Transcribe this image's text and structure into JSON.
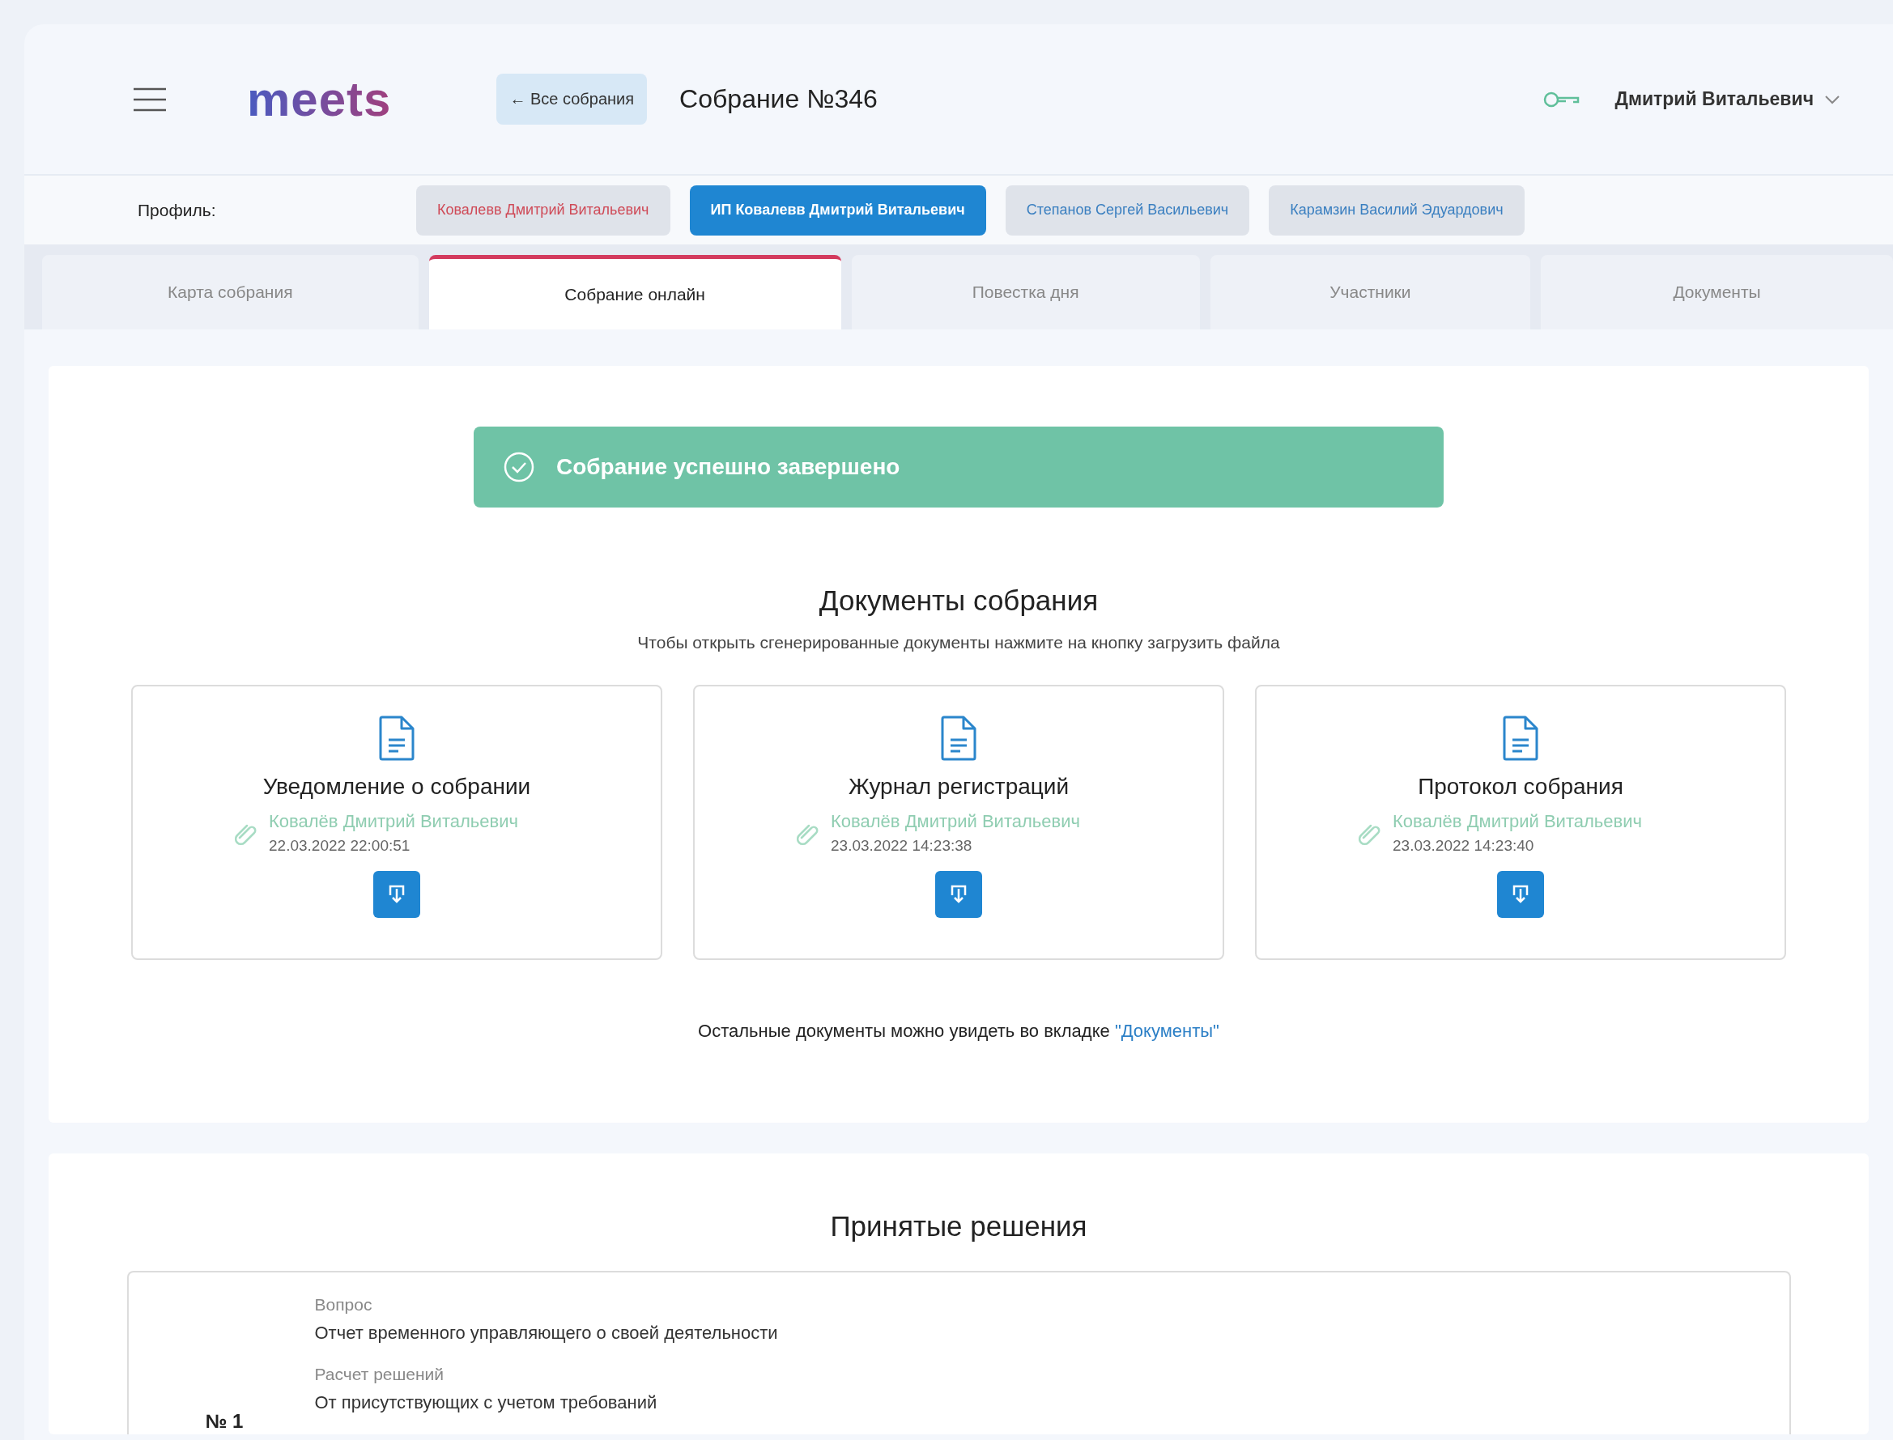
{
  "header": {
    "logo": "meets",
    "back_button": "← Все собрания",
    "title": "Собрание №346",
    "user": "Дмитрий Витальевич"
  },
  "profile": {
    "label": "Профиль:",
    "options": [
      {
        "label": "Ковалевв Дмитрий Витальевич",
        "selected": false,
        "color": "#cf4a57"
      },
      {
        "label": "ИП Ковалевв Дмитрий Витальевич",
        "selected": true
      },
      {
        "label": "Степанов Сергей Васильевич",
        "selected": false,
        "color": "#3a7fc0"
      },
      {
        "label": "Карамзин Василий Эдуардович",
        "selected": false,
        "color": "#3a7fc0"
      }
    ]
  },
  "tabs": [
    {
      "label": "Карта собрания",
      "selected": false
    },
    {
      "label": "Собрание онлайн",
      "selected": true
    },
    {
      "label": "Повестка дня",
      "selected": false
    },
    {
      "label": "Участники",
      "selected": false
    },
    {
      "label": "Документы",
      "selected": false
    }
  ],
  "banner": {
    "text": "Собрание успешно завершено"
  },
  "documents": {
    "title": "Документы собрания",
    "hint": "Чтобы открыть сгенерированные документы нажмите на кнопку загрузить файла",
    "cards": [
      {
        "title": "Уведомление о собрании",
        "author": "Ковалёв Дмитрий Витальевич",
        "date": "22.03.2022 22:00:51"
      },
      {
        "title": "Журнал регистраций",
        "author": "Ковалёв Дмитрий Витальевич",
        "date": "23.03.2022 14:23:38"
      },
      {
        "title": "Протокол собрания",
        "author": "Ковалёв Дмитрий Витальевич",
        "date": "23.03.2022 14:23:40"
      }
    ],
    "footer": {
      "text": "Остальные документы можно увидеть во вкладке",
      "link": "\"Документы\""
    }
  },
  "decisions": {
    "title": "Принятые решения",
    "items": [
      {
        "number": "№ 1",
        "fields": [
          {
            "label": "Вопрос",
            "value": "Отчет временного управляющего о своей деятельности"
          },
          {
            "label": "Расчет решений",
            "value": "От присутствующих с учетом требований"
          }
        ]
      }
    ]
  }
}
